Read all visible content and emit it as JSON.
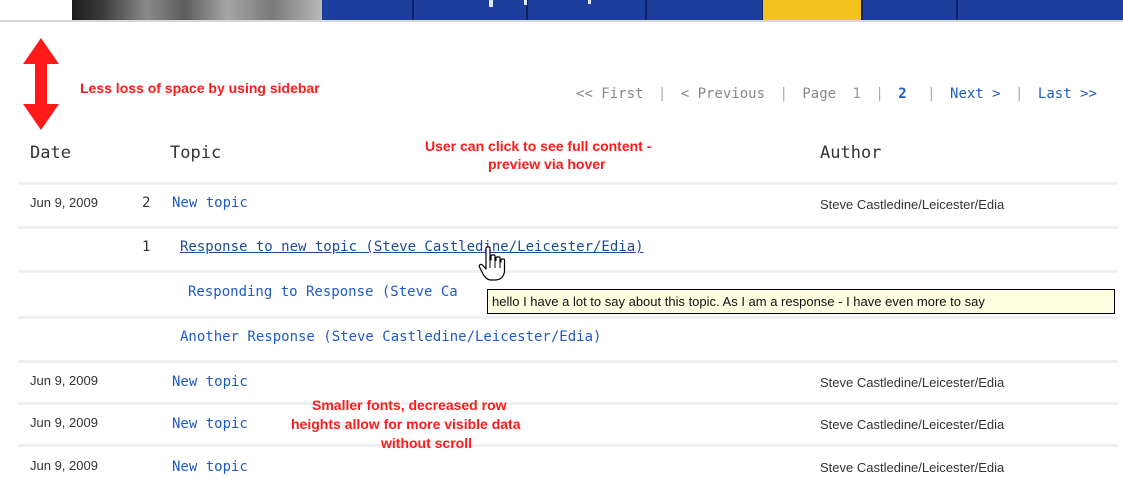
{
  "annotations": {
    "sidebar_note": "Less loss of space by using sidebar",
    "click_note_line1": "User can click to see full content -",
    "click_note_line2": "preview via hover",
    "fonts_note_line1": "Smaller fonts, decreased row",
    "fonts_note_line2": "heights allow for more visible data",
    "fonts_note_line3": "without scroll"
  },
  "pager": {
    "first": "<< First",
    "previous": "< Previous",
    "page_label": "Page",
    "page_1": "1",
    "page_2": "2",
    "next": "Next >",
    "last": "Last >>",
    "separator": "|"
  },
  "table": {
    "columns": {
      "date": "Date",
      "topic": "Topic",
      "author": "Author"
    },
    "rows": [
      {
        "date": "Jun 9, 2009",
        "count": "2",
        "topic": "New topic",
        "author": "Steve Castledine/Leicester/Edia"
      },
      {
        "date": "",
        "count": "1",
        "topic": "Response to new topic (Steve Castledine/Leicester/Edia)",
        "author": ""
      },
      {
        "date": "",
        "count": "",
        "topic": "Responding to Response (Steve Ca",
        "author": ""
      },
      {
        "date": "",
        "count": "",
        "topic": "Another Response (Steve Castledine/Leicester/Edia)",
        "author": ""
      },
      {
        "date": "Jun 9, 2009",
        "count": "",
        "topic": "New topic",
        "author": "Steve Castledine/Leicester/Edia"
      },
      {
        "date": "Jun 9, 2009",
        "count": "",
        "topic": "New topic",
        "author": "Steve Castledine/Leicester/Edia"
      },
      {
        "date": "Jun 9, 2009",
        "count": "",
        "topic": "New topic",
        "author": "Steve Castledine/Leicester/Edia"
      }
    ]
  },
  "tooltip": {
    "text": "hello I have a lot to say about this topic. As I am a response - I have even more to say"
  },
  "icons": {
    "arrow": "double-headed-arrow-icon",
    "cursor": "hand-pointer-icon"
  },
  "colors": {
    "nav_blue": "#1c3f9e",
    "accent_yellow": "#f4c21e",
    "link_blue": "#1e5bc4",
    "annotation_red": "#ff1a1a",
    "tooltip_bg": "#ffffe1"
  }
}
